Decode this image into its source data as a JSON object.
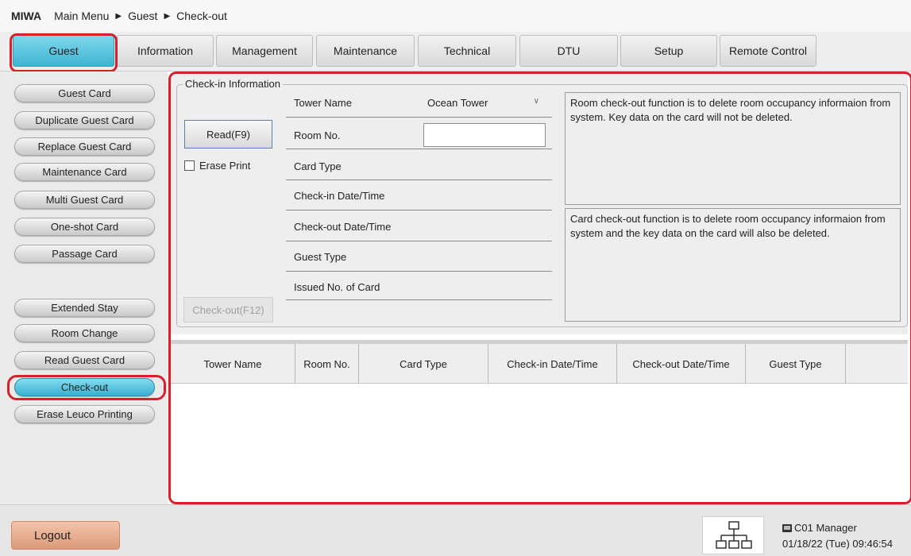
{
  "breadcrumb": {
    "brand": "MIWA",
    "items": [
      "Main Menu",
      "Guest",
      "Check-out"
    ]
  },
  "tabs": [
    {
      "label": "Guest",
      "active": true
    },
    {
      "label": "Information",
      "active": false
    },
    {
      "label": "Management",
      "active": false
    },
    {
      "label": "Maintenance",
      "active": false
    },
    {
      "label": "Technical",
      "active": false
    },
    {
      "label": "DTU",
      "active": false
    },
    {
      "label": "Setup",
      "active": false
    },
    {
      "label": "Remote Control",
      "active": false
    }
  ],
  "sidebar": {
    "items": [
      {
        "label": "Guest Card",
        "active": false
      },
      {
        "label": "Duplicate Guest Card",
        "active": false
      },
      {
        "label": "Replace Guest Card",
        "active": false
      },
      {
        "label": "Maintenance Card",
        "active": false
      },
      {
        "label": "Multi Guest Card",
        "active": false
      },
      {
        "label": "One-shot Card",
        "active": false
      },
      {
        "label": "Passage Card",
        "active": false
      },
      {
        "label": "Extended Stay",
        "active": false
      },
      {
        "label": "Room Change",
        "active": false
      },
      {
        "label": "Read Guest Card",
        "active": false
      },
      {
        "label": "Check-out",
        "active": true
      },
      {
        "label": "Erase Leuco Printing",
        "active": false
      }
    ]
  },
  "checkin": {
    "legend": "Check-in Information",
    "read_button": "Read(F9)",
    "erase_print_label": "Erase Print",
    "erase_print_checked": false,
    "checkout_button": "Check-out(F12)",
    "fields": {
      "tower_name": "Tower Name",
      "room_no": "Room No.",
      "card_type": "Card Type",
      "checkin_datetime": "Check-in Date/Time",
      "checkout_datetime": "Check-out Date/Time",
      "guest_type": "Guest Type",
      "issued_no": "Issued No. of Card"
    },
    "tower_select_value": "Ocean Tower",
    "room_no_value": "",
    "room_info": "Room check-out function is to delete room occupancy informaion from system. Key data on the card will not be deleted.",
    "card_info": "Card check-out function is to delete room occupancy informaion from system and the key data on the card will also be deleted."
  },
  "table": {
    "columns": [
      "Tower Name",
      "Room No.",
      "Card Type",
      "Check-in Date/Time",
      "Check-out Date/Time",
      "Guest Type"
    ],
    "rows": []
  },
  "footer": {
    "logout": "Logout",
    "user": "C01 Manager",
    "datetime": "01/18/22 (Tue) 09:46:54"
  },
  "icons": {
    "network": "network-icon",
    "monitor": "monitor-icon",
    "dropdown": "chevron-down-icon"
  },
  "colors": {
    "active_blue": "#3fb4d3",
    "highlight_red": "#d8202a",
    "logout_orange": "#dc9b79"
  }
}
